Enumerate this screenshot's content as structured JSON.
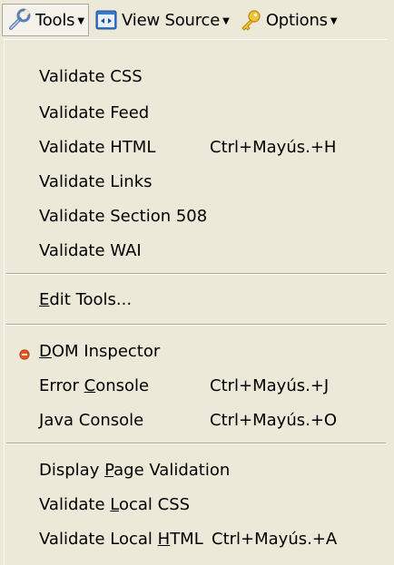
{
  "toolbar": {
    "tools_label": "Tools",
    "view_source_label": "View Source",
    "options_label": "Options"
  },
  "menu": {
    "validate_css": "Validate CSS",
    "validate_feed": "Validate Feed",
    "validate_html": "Validate HTML",
    "validate_html_shortcut": "Ctrl+Mayús.+H",
    "validate_links": "Validate Links",
    "validate_section_508": "Validate Section 508",
    "validate_wai": "Validate WAI",
    "edit_tools": {
      "mnemonic": "E",
      "rest": "dit Tools..."
    },
    "dom_inspector": {
      "mnemonic": "D",
      "rest": "OM Inspector"
    },
    "error_console": {
      "before": "Error ",
      "mnemonic": "C",
      "rest": "onsole"
    },
    "error_console_shortcut": "Ctrl+Mayús.+J",
    "java_console": {
      "mnemonic": "J",
      "rest": "ava Console"
    },
    "java_console_shortcut": "Ctrl+Mayús.+O",
    "display_page_validation": {
      "before": "Display ",
      "mnemonic": "P",
      "rest": "age Validation"
    },
    "validate_local_css": {
      "before": "Validate ",
      "mnemonic": "L",
      "rest": "ocal CSS"
    },
    "validate_local_html": {
      "before": "Validate Local ",
      "mnemonic": "H",
      "rest": "TML"
    },
    "validate_local_html_shortcut": "Ctrl+Mayús.+A"
  },
  "icons": {
    "tools": "wrench-icon",
    "view_source": "view-source-icon",
    "options": "key-icon",
    "dom_inspector": "bullet-icon"
  },
  "colors": {
    "menu_bg": "#ece9d8",
    "bullet": "#e0581f"
  }
}
